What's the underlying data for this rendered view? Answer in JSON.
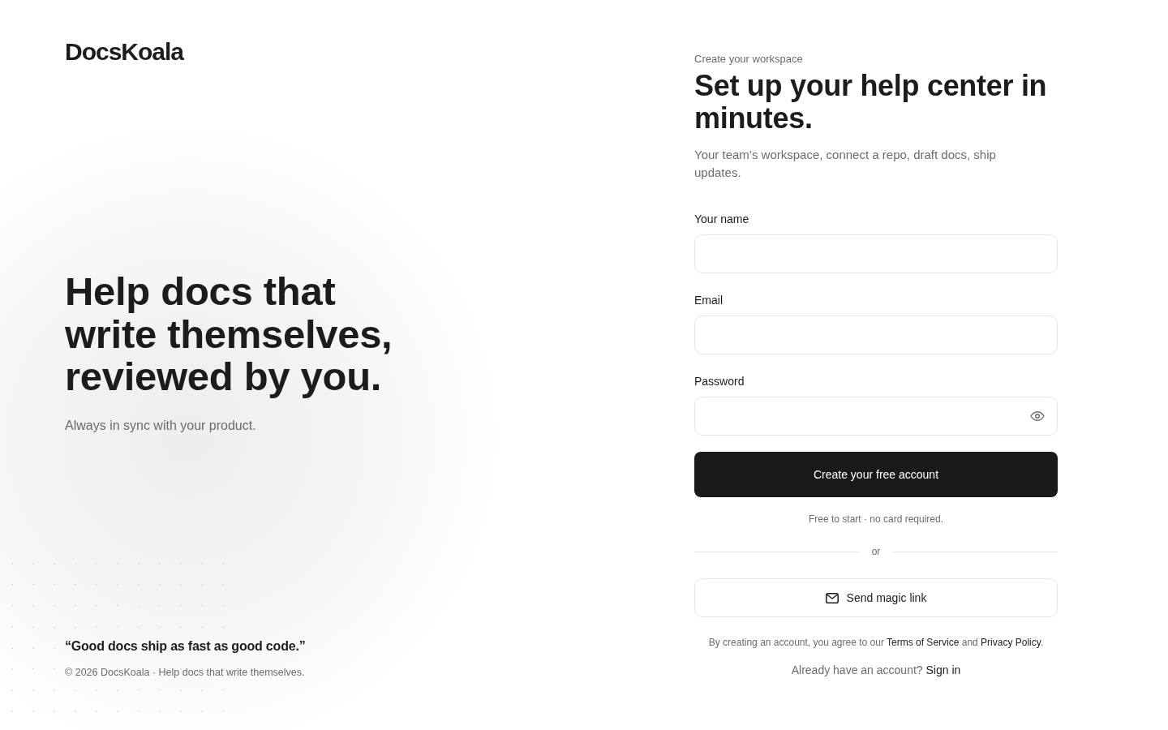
{
  "brand": {
    "logo": "DocsKoala"
  },
  "hero": {
    "headline": "Help docs that write themselves, reviewed by you.",
    "tagline": "Always in sync with your product.",
    "quote": "“Good docs ship as fast as good code.”",
    "footer": "© 2026 DocsKoala · Help docs that write themselves."
  },
  "form": {
    "eyebrow": "Create your workspace",
    "title": "Set up your help center in minutes.",
    "subtitle": "Your team’s workspace, connect a repo, draft docs, ship updates.",
    "fields": [
      {
        "label": "Your name",
        "kind": "text"
      },
      {
        "label": "Email",
        "kind": "email"
      },
      {
        "label": "Password",
        "kind": "password"
      }
    ],
    "submit": "Create your free account",
    "note": "Free to start · no card required.",
    "divider": "or",
    "magic_link": "Send magic link",
    "legal": {
      "before": "By creating an account, you agree to our",
      "terms_link": "Terms of Service",
      "middle": "and",
      "privacy_link": "Privacy Policy",
      "after": "."
    },
    "signin": {
      "prompt": "Already have an account?",
      "link": "Sign in"
    }
  }
}
